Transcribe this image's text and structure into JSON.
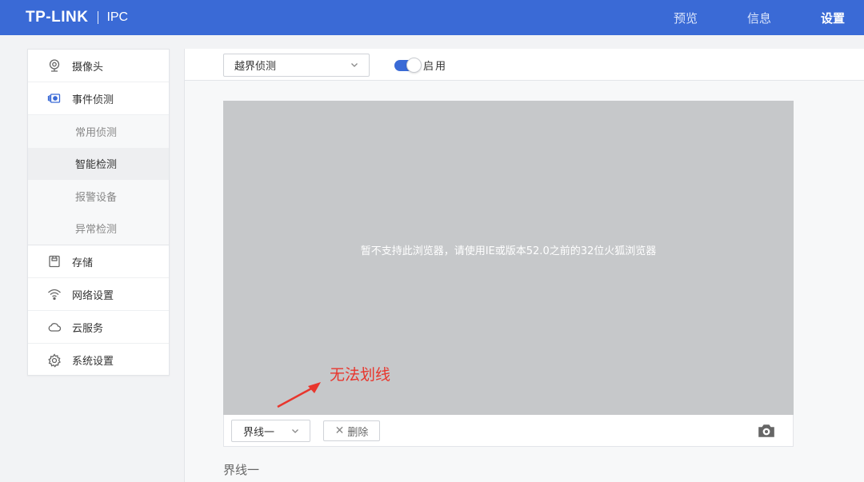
{
  "header": {
    "brand": "TP-LINK",
    "product": "IPC",
    "nav": [
      {
        "label": "预览",
        "active": false
      },
      {
        "label": "信息",
        "active": false
      },
      {
        "label": "设置",
        "active": true
      }
    ]
  },
  "sidebar": {
    "items": [
      {
        "label": "摄像头",
        "icon": "camera-lens-icon"
      },
      {
        "label": "事件侦测",
        "icon": "event-detect-icon"
      },
      {
        "label": "存储",
        "icon": "storage-icon"
      },
      {
        "label": "网络设置",
        "icon": "wifi-icon"
      },
      {
        "label": "云服务",
        "icon": "cloud-icon"
      },
      {
        "label": "系统设置",
        "icon": "gear-icon"
      }
    ],
    "sub_items": [
      {
        "label": "常用侦测",
        "active": false
      },
      {
        "label": "智能检测",
        "active": true
      },
      {
        "label": "报警设备",
        "active": false
      },
      {
        "label": "异常检测",
        "active": false
      }
    ]
  },
  "toolbar": {
    "detect_mode": "越界侦测",
    "enable_label": "启用",
    "enabled": true
  },
  "video": {
    "message": "暂不支持此浏览器，请使用IE或版本52.0之前的32位火狐浏览器",
    "annotation": "无法划线"
  },
  "video_bar": {
    "line_select": "界线一",
    "delete_label": "删除"
  },
  "section": {
    "label": "界线一"
  },
  "colors": {
    "header": "#3a6ad6",
    "video_bg": "#c6c8ca",
    "annotation": "#e8362d"
  }
}
